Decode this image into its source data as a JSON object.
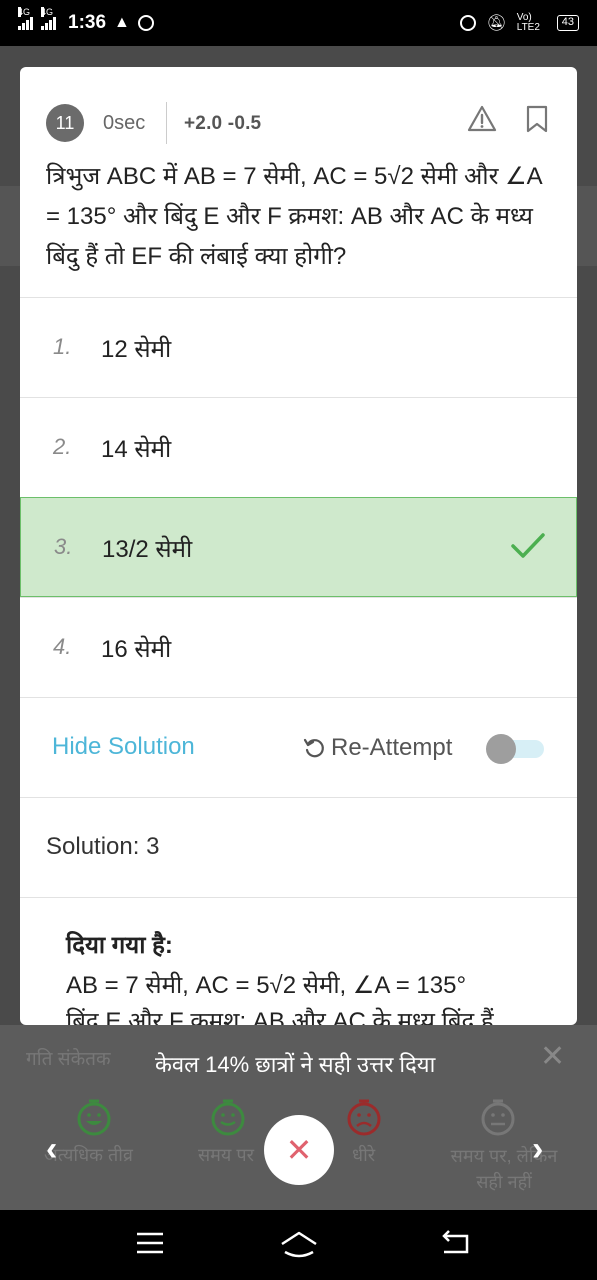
{
  "status_bar": {
    "network1": "4G",
    "network2": "4G",
    "time": "1:36",
    "volte": "Vo) LTE2",
    "battery": "43"
  },
  "question": {
    "number": "11",
    "time": "0sec",
    "marks": "+2.0  -0.5",
    "text": "त्रिभुज ABC में AB = 7 सेमी, AC = 5√2 सेमी और ∠A = 135° और बिंदु E और F क्रमश: AB और AC के मध्य बिंदु हैं तो EF की लंबाई क्या होगी?",
    "warn_icon": "warning-icon",
    "bookmark_icon": "bookmark-icon"
  },
  "options": [
    {
      "num": "1.",
      "text": "12 सेमी"
    },
    {
      "num": "2.",
      "text": "14 सेमी"
    },
    {
      "num": "3.",
      "text": "13/2 सेमी"
    },
    {
      "num": "4.",
      "text": "16 सेमी"
    }
  ],
  "correct_option_index": 2,
  "actions": {
    "hide_solution": "Hide Solution",
    "reattempt": "Re-Attempt"
  },
  "solution": {
    "header": "Solution: 3",
    "given": "दिया गया है:",
    "line1": "AB = 7 सेमी, AC = 5√2 सेमी, ∠A = 135°",
    "line2": "बिंदु E और F क्रमश: AB और AC के मध्य बिंदु हैं"
  },
  "bottom_panel": {
    "label": "गति संकेतक",
    "message": "केवल 14% छात्रों ने सही उत्तर दिया",
    "speeds": [
      {
        "label": "अत्यधिक तीव्र",
        "icon": "fast-face-icon",
        "color": "#4caf50"
      },
      {
        "label": "समय पर",
        "icon": "ontime-face-icon",
        "color": "#4caf50"
      },
      {
        "label": "धीरे",
        "icon": "slow-face-icon",
        "color": "#e53935"
      },
      {
        "label": "समय पर, लेकिन सही नहीं",
        "icon": "neutral-face-icon",
        "color": "#9e9e9e"
      }
    ]
  },
  "colors": {
    "correct_bg": "#cfe9cc",
    "correct_border": "#6cbf6a",
    "link": "#4db6d8"
  }
}
